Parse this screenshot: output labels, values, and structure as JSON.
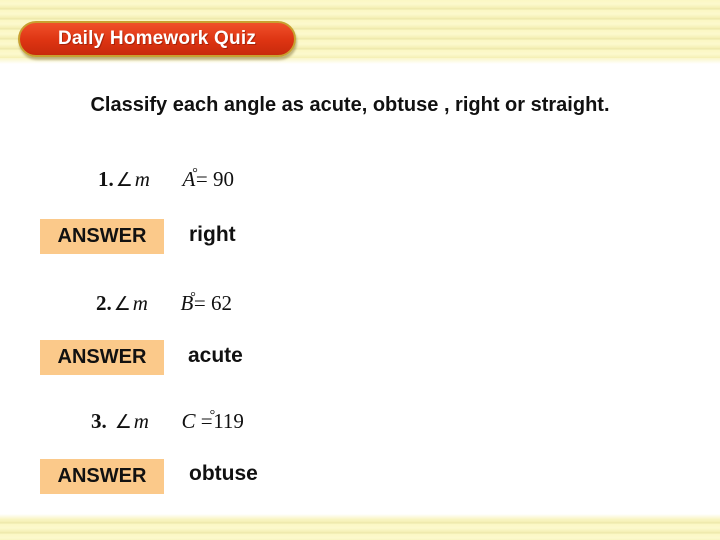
{
  "header": {
    "title": "Daily Homework Quiz"
  },
  "prompt": "Classify each angle as acute, obtuse , right or straight.",
  "questions": [
    {
      "number": "1.",
      "angle_symbol": "∠",
      "measure_label": "m",
      "variable": "A",
      "equals": "=",
      "degree_symbol": "°",
      "value": "90",
      "answer_label": "ANSWER",
      "answer": "right"
    },
    {
      "number": "2.",
      "angle_symbol": "∠",
      "measure_label": "m",
      "variable": "B",
      "equals": "=",
      "degree_symbol": "°",
      "value": "62",
      "answer_label": "ANSWER",
      "answer": "acute"
    },
    {
      "number": "3.",
      "angle_symbol": "∠",
      "measure_label": "m",
      "variable": "C",
      "equals": "=",
      "degree_symbol": "°",
      "value": "119",
      "answer_label": "ANSWER",
      "answer": "obtuse"
    }
  ],
  "colors": {
    "banner_red": "#dd3412",
    "banner_border": "#c8a030",
    "answer_badge": "#fbc98a",
    "stripe_yellow": "#fbf7c4"
  }
}
